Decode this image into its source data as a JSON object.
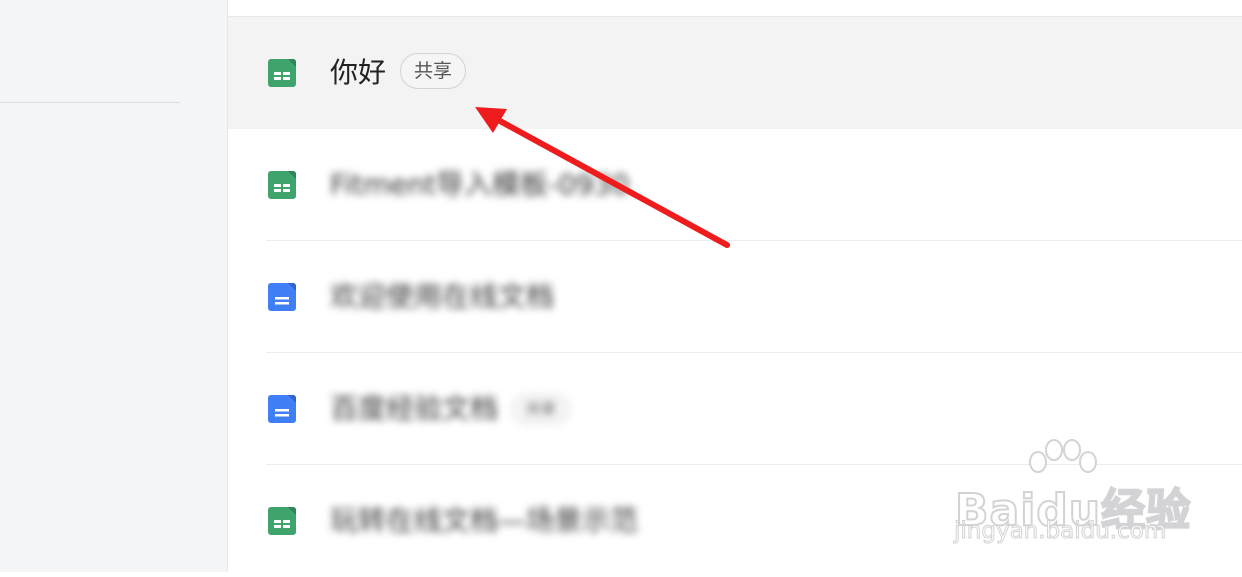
{
  "files": [
    {
      "name": "你好",
      "type": "sheet",
      "badge": "共享",
      "selected": true,
      "blurred": false
    },
    {
      "name": "Fitment导入模板-0930",
      "type": "sheet",
      "badge": "",
      "selected": false,
      "blurred": true
    },
    {
      "name": "欢迎使用在线文档",
      "type": "doc",
      "badge": "",
      "selected": false,
      "blurred": true
    },
    {
      "name": "百度经验文档",
      "type": "doc",
      "badge": "共享",
      "selected": false,
      "blurred": true
    },
    {
      "name": "玩转在线文档—场景示范",
      "type": "sheet",
      "badge": "",
      "selected": false,
      "blurred": true
    }
  ],
  "icons": {
    "sheet": "spreadsheet-icon",
    "doc": "document-icon"
  },
  "colors": {
    "sheet": "#3ea46b",
    "doc": "#3f7ef5",
    "arrow": "#ee1c1c",
    "selected_row": "#f3f3f4"
  },
  "watermark": {
    "logo": "Baidu经验",
    "url": "jingyan.baidu.com"
  }
}
